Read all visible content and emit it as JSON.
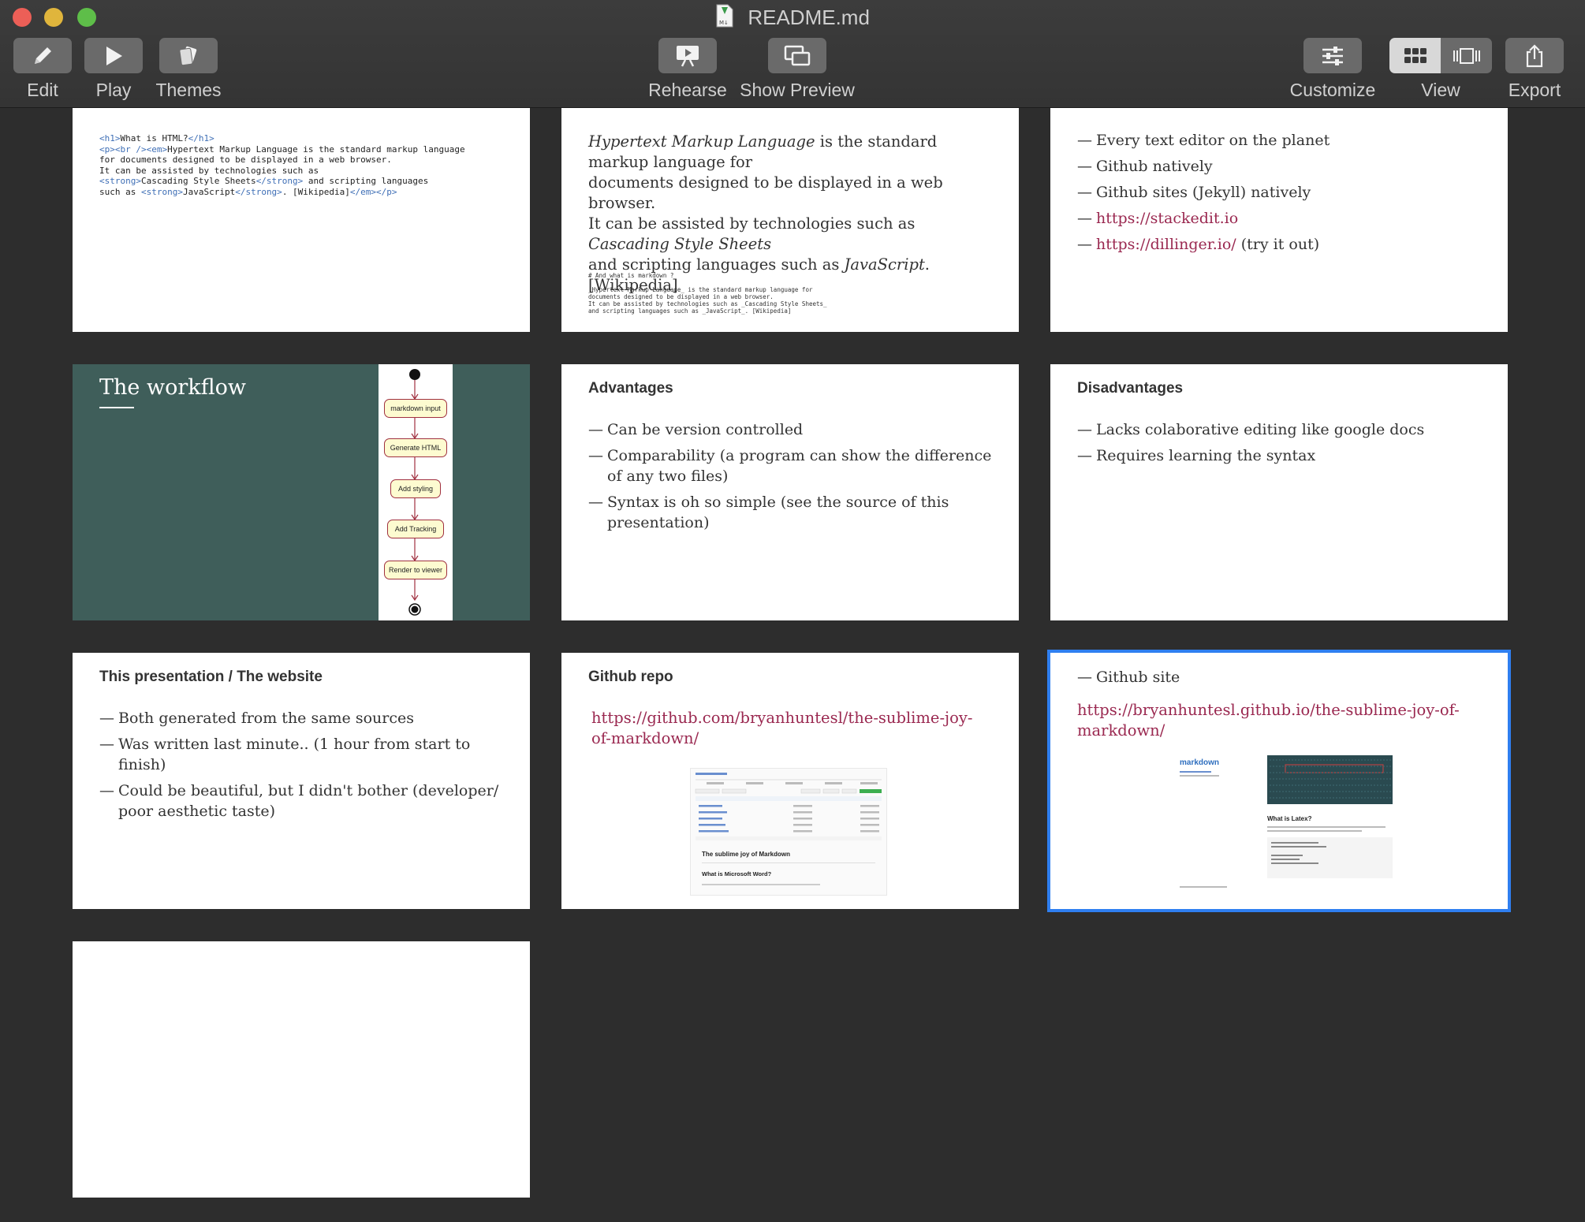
{
  "window": {
    "title": "README.md",
    "doc_icon_label": "M↓"
  },
  "toolbar": {
    "edit": "Edit",
    "play": "Play",
    "themes": "Themes",
    "rehearse": "Rehearse",
    "show_preview": "Show Preview",
    "customize": "Customize",
    "view": "View",
    "export": "Export"
  },
  "slides": {
    "s1": {
      "line1_a": "<h1>",
      "line1_b": "What is HTML?",
      "line1_c": "</h1>",
      "line2_a": "<p><br /><em>",
      "line2_b": "Hypertext Markup Language is the standard markup language",
      "line3": "for documents designed to be displayed in a web browser.",
      "line4": "It can be assisted by technologies such as",
      "line5_a": "<strong>",
      "line5_b": "Cascading Style Sheets",
      "line5_c": "</strong>",
      "line5_d": " and scripting languages",
      "line6_a": "such as ",
      "line6_b": "<strong>",
      "line6_c": "JavaScript",
      "line6_d": "</strong>",
      "line6_e": ". [Wikipedia]",
      "line6_f": "</em></p>"
    },
    "s2": {
      "em1": "Hypertext Markup Language",
      "t1": " is the standard markup language for",
      "t2": "documents designed to be displayed in a web browser.",
      "t3": "It can be assisted by technologies such as ",
      "em2": "Cascading Style Sheets",
      "t4": "and scripting languages such as ",
      "em3": "JavaScript",
      "t5": ". [Wikipedia]",
      "code": "# And what is markdown ?\n\n_Hypertext Markup Language_ is the standard markup language for\ndocuments designed to be displayed in a web browser.\nIt can be assisted by technologies such as _Cascading Style Sheets_\nand scripting languages such as _JavaScript_. [Wikipedia]"
    },
    "s3": {
      "items": [
        "Every text editor on the planet",
        "Github natively",
        "Github sites (Jekyll) natively"
      ],
      "link1": "https://stackedit.io",
      "link2": "https://dillinger.io/",
      "link2_suffix": " (try it out)"
    },
    "s4": {
      "title": "The workflow",
      "nodes": [
        "markdown input",
        "Generate HTML",
        "Add styling",
        "Add Tracking",
        "Render to viewer"
      ]
    },
    "s5": {
      "heading": "Advantages",
      "items": [
        "Can be version controlled",
        "Comparability (a program can show the difference of any two files)",
        "Syntax is oh so simple (see the source of this presentation)"
      ]
    },
    "s6": {
      "heading": "Disadvantages",
      "items": [
        "Lacks colaborative editing like google docs",
        "Requires learning the syntax"
      ]
    },
    "s7": {
      "heading": "This presentation / The website",
      "items": [
        "Both generated from the same sources",
        "Was written last minute.. (1 hour from start to finish)",
        "Could be beautiful, but I didn't bother (developer/ poor aesthetic taste)"
      ]
    },
    "s8": {
      "heading": "Github repo",
      "link": "https://github.com/bryanhuntesl/the-sublime-joy-of-markdown/",
      "shot_title": "The sublime joy of Markdown",
      "shot_sub": "What is Microsoft Word?"
    },
    "s9": {
      "item": "Github site",
      "link": "https://bryanhuntesl.github.io/the-sublime-joy-of-markdown/",
      "shot_title": "markdown",
      "shot_sub": "What is Latex?"
    }
  }
}
